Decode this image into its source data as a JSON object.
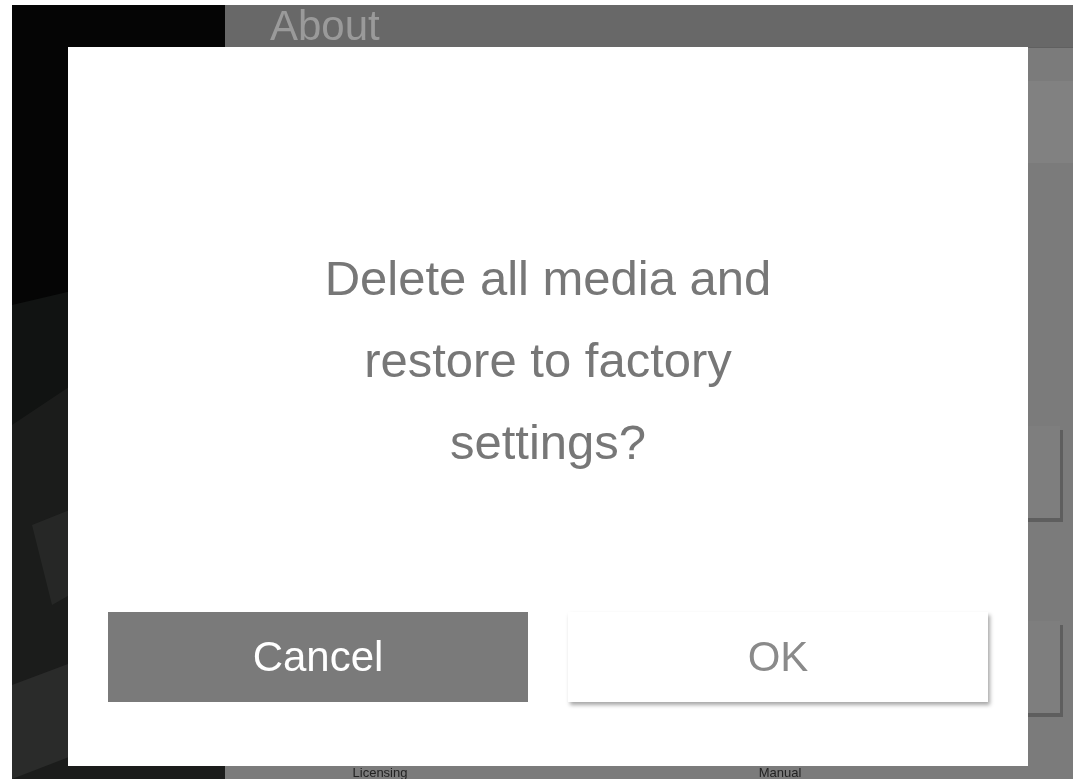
{
  "header": {
    "title": "About"
  },
  "dialog": {
    "message": "Delete all media and restore to factory settings?",
    "buttons": [
      {
        "label": "Cancel",
        "kind": "secondary"
      },
      {
        "label": "OK",
        "kind": "primary"
      }
    ]
  },
  "background_labels": [
    "Licensing",
    "Manual"
  ]
}
